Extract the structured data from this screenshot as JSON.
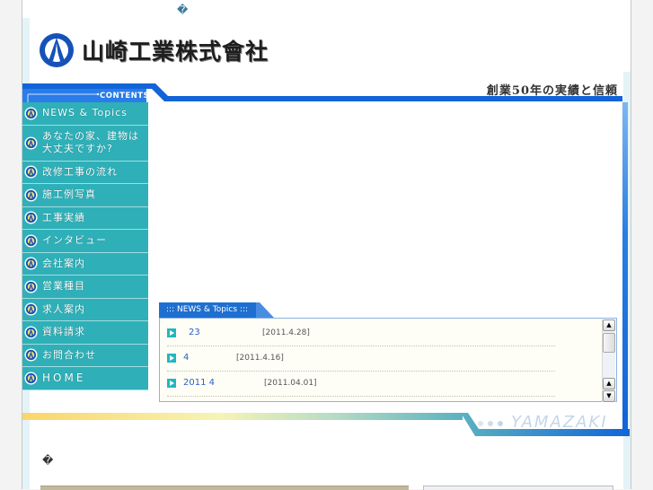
{
  "top_glyph": "�",
  "company": {
    "name": "山崎工業株式會社",
    "tagline": "創業50年の実績と信頼",
    "footer_brand": "YAMAZAKI"
  },
  "header": {
    "contents_label": "CONTENTS"
  },
  "nav": {
    "items": [
      {
        "label": "NEWS & Topics"
      },
      {
        "label": "あなたの家、建物は大丈夫ですか?",
        "line1": "あなたの家、建物は",
        "line2": "大丈夫ですか?"
      },
      {
        "label": "改修工事の流れ"
      },
      {
        "label": "施工例写真"
      },
      {
        "label": "工事実績"
      },
      {
        "label": "インタビュー"
      },
      {
        "label": "会社案内"
      },
      {
        "label": "営業種目"
      },
      {
        "label": "求人案内"
      },
      {
        "label": "資料請求"
      },
      {
        "label": "お問合わせ"
      },
      {
        "label": "HOME"
      }
    ]
  },
  "news": {
    "tab_label": "::: NEWS & Topics :::",
    "items": [
      {
        "title": "23",
        "date": "[2011.4.28]"
      },
      {
        "title": "4",
        "date": "[2011.4.16]"
      },
      {
        "title": "2011 4",
        "date": "[2011.04.01]"
      }
    ],
    "scroll_up": "▲",
    "scroll_down": "▼"
  },
  "bottom_glyph": "�",
  "colors": {
    "nav_teal": "#2fb0b8",
    "header_blue": "#1264d8",
    "news_link": "#2a62c8"
  }
}
